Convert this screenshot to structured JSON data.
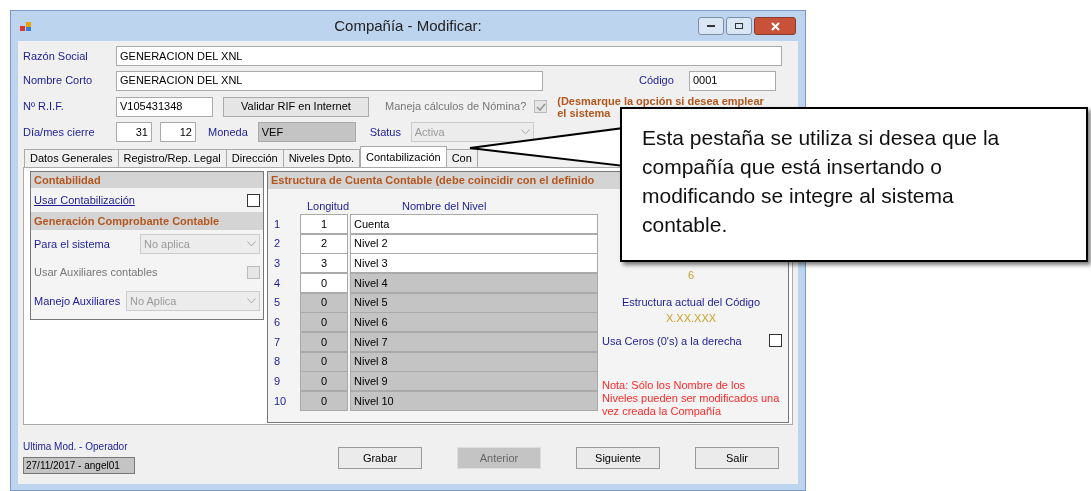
{
  "window": {
    "title": "Compañía - Modificar:"
  },
  "razon_social": {
    "label": "Razón Social",
    "value": "GENERACION DEL XNL"
  },
  "nombre_corto": {
    "label": "Nombre Corto",
    "value": "GENERACION DEL XNL"
  },
  "codigo": {
    "label": "Código",
    "value": "0001"
  },
  "rif": {
    "label": "Nº R.I.F.",
    "value": "V105431348"
  },
  "validate_button": {
    "label": "Validar RIF en Internet"
  },
  "nomina": {
    "label": "Maneja cálculos de Nómina?",
    "checked": true,
    "disabled": true
  },
  "nomina_note": [
    "(Desmarque la opción si desea emplear",
    "el sistema"
  ],
  "dia_mes": {
    "label": "Día/mes cierre",
    "day": "31",
    "month": "12"
  },
  "moneda": {
    "label": "Moneda",
    "value": "VEF"
  },
  "status": {
    "label": "Status",
    "value": "Activa"
  },
  "tabs": [
    {
      "label": "Datos Generales",
      "selected": false
    },
    {
      "label": "Registro/Rep. Legal",
      "selected": false
    },
    {
      "label": "Dirección",
      "selected": false
    },
    {
      "label": "Niveles Dpto.",
      "selected": false
    },
    {
      "label": "Contabilización",
      "selected": true
    },
    {
      "label": "Con",
      "selected": false
    }
  ],
  "contabilidad": {
    "title": "Contabilidad",
    "usar": {
      "label": "Usar Contabilización",
      "checked": false
    },
    "section": "Generación Comprobante Contable",
    "para_el_sistema": {
      "label": "Para el sistema",
      "value": "No aplica"
    },
    "usar_aux": {
      "label": "Usar Auxiliares contables",
      "checked": false,
      "disabled": true
    },
    "manejo": {
      "label": "Manejo Auxiliares",
      "value": "No Aplica"
    }
  },
  "estructura": {
    "title": "Estructura de Cuenta Contable (debe coincidir con el definido",
    "columns": [
      "Longitud",
      "Nombre del Nivel"
    ],
    "rows": [
      {
        "number": "1",
        "length": "1",
        "name": "Cuenta",
        "length_disabled": false,
        "name_disabled": false
      },
      {
        "number": "2",
        "length": "2",
        "name": "Nivel 2",
        "length_disabled": false,
        "name_disabled": false
      },
      {
        "number": "3",
        "length": "3",
        "name": "Nivel 3",
        "length_disabled": false,
        "name_disabled": false
      },
      {
        "number": "4",
        "length": "0",
        "name": "Nivel 4",
        "length_disabled": false,
        "name_disabled": true
      },
      {
        "number": "5",
        "length": "0",
        "name": "Nivel 5",
        "length_disabled": true,
        "name_disabled": true
      },
      {
        "number": "6",
        "length": "0",
        "name": "Nivel 6",
        "length_disabled": true,
        "name_disabled": true
      },
      {
        "number": "7",
        "length": "0",
        "name": "Nivel 7",
        "length_disabled": true,
        "name_disabled": true
      },
      {
        "number": "8",
        "length": "0",
        "name": "Nivel 8",
        "length_disabled": true,
        "name_disabled": true
      },
      {
        "number": "9",
        "length": "0",
        "name": "Nivel 9",
        "length_disabled": true,
        "name_disabled": true
      },
      {
        "number": "10",
        "length": "0",
        "name": "Nivel 10",
        "length_disabled": true,
        "name_disabled": true
      }
    ],
    "count": "6",
    "structure_label": "Estructura actual del Código",
    "structure": "X.XX.XXX",
    "ceros": {
      "label": "Usa Ceros (0's) a la derecha",
      "checked": false
    },
    "note": "Nota: Sólo los Nombre de los Niveles pueden ser modificados una vez creada la Compañía"
  },
  "last_mod": {
    "label": "Ultima Mod. - Operador",
    "value": "27/11/2017 - angel01"
  },
  "buttons": [
    {
      "label": "Grabar",
      "disabled": false
    },
    {
      "label": "Anterior",
      "disabled": true
    },
    {
      "label": "Siguiente",
      "disabled": false
    },
    {
      "label": "Salir",
      "disabled": false
    }
  ],
  "callout": {
    "text": "Esta pestaña se utiliza si desea que la compañía que está insertando o modificando se integre al sistema contable."
  }
}
